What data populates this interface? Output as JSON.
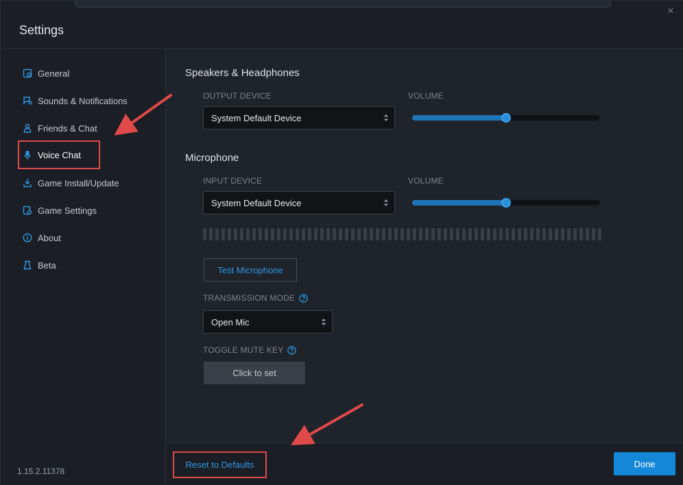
{
  "window": {
    "title": "Settings",
    "close_glyph": "×"
  },
  "sidebar": {
    "items": [
      {
        "label": "General",
        "icon": "gear-icon"
      },
      {
        "label": "Sounds & Notifications",
        "icon": "bell-icon"
      },
      {
        "label": "Friends & Chat",
        "icon": "person-icon"
      },
      {
        "label": "Voice Chat",
        "icon": "microphone-icon",
        "active": true
      },
      {
        "label": "Game Install/Update",
        "icon": "download-icon"
      },
      {
        "label": "Game Settings",
        "icon": "gamepad-icon"
      },
      {
        "label": "About",
        "icon": "info-icon"
      },
      {
        "label": "Beta",
        "icon": "flask-icon"
      }
    ],
    "version": "1.15.2.11378"
  },
  "speakers": {
    "title": "Speakers & Headphones",
    "output_label": "OUTPUT DEVICE",
    "output_value": "System Default Device",
    "volume_label": "VOLUME",
    "volume_level": 0.5
  },
  "microphone": {
    "title": "Microphone",
    "input_label": "INPUT DEVICE",
    "input_value": "System Default Device",
    "volume_label": "VOLUME",
    "volume_level": 0.5,
    "test_button": "Test Microphone"
  },
  "transmission": {
    "label": "TRANSMISSION MODE",
    "value": "Open Mic"
  },
  "mute_key": {
    "label": "TOGGLE MUTE KEY",
    "button": "Click to set"
  },
  "footer": {
    "reset_label": "Reset to Defaults",
    "done_label": "Done"
  },
  "colors": {
    "accent": "#1587d9",
    "link": "#2e9ae6",
    "highlight": "#e04a4a",
    "background": "#1f232a"
  }
}
